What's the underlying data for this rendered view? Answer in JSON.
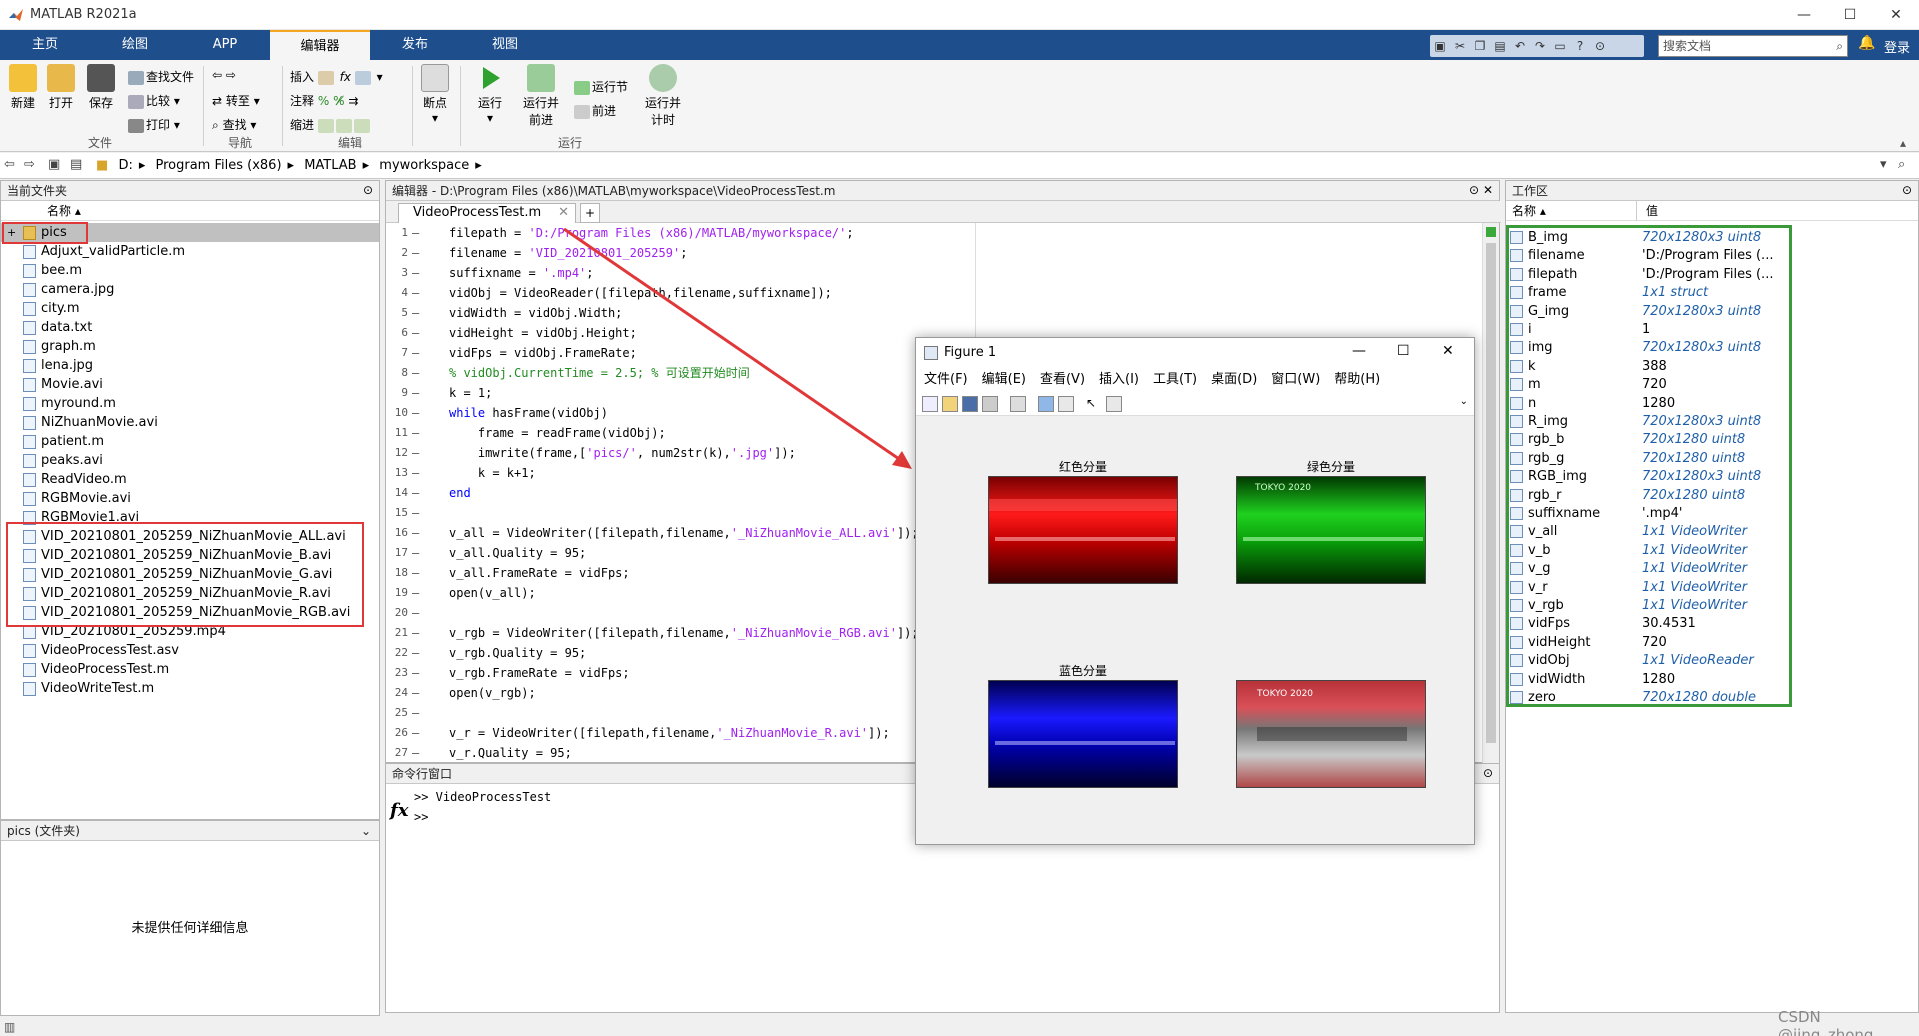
{
  "app": {
    "title": "MATLAB R2021a"
  },
  "ribbon_tabs": [
    "主页",
    "绘图",
    "APP",
    "编辑器",
    "发布",
    "视图"
  ],
  "search": {
    "placeholder": "搜索文档"
  },
  "login_label": "登录",
  "ribbon": {
    "new": "新建",
    "open": "打开",
    "save": "保存",
    "find_files": "查找文件",
    "compare": "比较",
    "print": "打印",
    "group_file": "文件",
    "goto": "转至",
    "find": "查找",
    "group_nav": "导航",
    "insert": "插入",
    "comment": "注释",
    "indent": "缩进",
    "group_edit": "编辑",
    "breakpoints": "断点",
    "run": "运行",
    "run_advance": "运行并\n前进",
    "run_section": "运行节",
    "advance": "前进",
    "run_time": "运行并\n计时",
    "group_run": "运行"
  },
  "address": [
    "D:",
    "Program Files (x86)",
    "MATLAB",
    "myworkspace"
  ],
  "file_browser": {
    "title": "当前文件夹",
    "col_name": "名称",
    "items": [
      "pics",
      "Adjuxt_validParticle.m",
      "bee.m",
      "camera.jpg",
      "city.m",
      "data.txt",
      "graph.m",
      "lena.jpg",
      "Movie.avi",
      "myround.m",
      "NiZhuanMovie.avi",
      "patient.m",
      "peaks.avi",
      "ReadVideo.m",
      "RGBMovie.avi",
      "RGBMovie1.avi",
      "VID_20210801_205259_NiZhuanMovie_ALL.avi",
      "VID_20210801_205259_NiZhuanMovie_B.avi",
      "VID_20210801_205259_NiZhuanMovie_G.avi",
      "VID_20210801_205259_NiZhuanMovie_R.avi",
      "VID_20210801_205259_NiZhuanMovie_RGB.avi",
      "VID_20210801_205259.mp4",
      "VideoProcessTest.asv",
      "VideoProcessTest.m",
      "VideoWriteTest.m"
    ],
    "details_title": "pics (文件夹)",
    "details_text": "未提供任何详细信息"
  },
  "editor": {
    "title": "编辑器 - D:\\Program Files (x86)\\MATLAB\\myworkspace\\VideoProcessTest.m",
    "tab": "VideoProcessTest.m",
    "lines": [
      {
        "n": "1",
        "parts": [
          [
            "",
            "filepath = "
          ],
          [
            "str",
            "'D:/Program Files (x86)/MATLAB/myworkspace/'"
          ],
          [
            "",
            ";"
          ]
        ]
      },
      {
        "n": "2",
        "parts": [
          [
            "",
            "filename = "
          ],
          [
            "str",
            "'VID_20210801_205259'"
          ],
          [
            "",
            ";"
          ]
        ]
      },
      {
        "n": "3",
        "parts": [
          [
            "",
            "suffixname = "
          ],
          [
            "str",
            "'.mp4'"
          ],
          [
            "",
            ";"
          ]
        ]
      },
      {
        "n": "4",
        "parts": [
          [
            "",
            "vidObj = VideoReader([filepath,filename,suffixname]);"
          ]
        ]
      },
      {
        "n": "5",
        "parts": [
          [
            "",
            "vidWidth = vidObj.Width;"
          ]
        ]
      },
      {
        "n": "6",
        "parts": [
          [
            "",
            "vidHeight = vidObj.Height;"
          ]
        ]
      },
      {
        "n": "7",
        "parts": [
          [
            "",
            "vidFps = vidObj.FrameRate;"
          ]
        ]
      },
      {
        "n": "8",
        "parts": [
          [
            "cm",
            "% vidObj.CurrentTime = 2.5; % 可设置开始时间"
          ]
        ]
      },
      {
        "n": "9",
        "parts": [
          [
            "",
            "k = 1;"
          ]
        ]
      },
      {
        "n": "10",
        "parts": [
          [
            "kw",
            "while"
          ],
          [
            "",
            " hasFrame(vidObj)"
          ]
        ]
      },
      {
        "n": "11",
        "parts": [
          [
            "",
            "    frame = readFrame(vidObj);"
          ]
        ]
      },
      {
        "n": "12",
        "parts": [
          [
            "",
            "    imwrite(frame,["
          ],
          [
            "str",
            "'pics/'"
          ],
          [
            "",
            ", num2str(k),"
          ],
          [
            "str",
            "'.jpg'"
          ],
          [
            "",
            "]);"
          ]
        ]
      },
      {
        "n": "13",
        "parts": [
          [
            "",
            "    k = k+1;"
          ]
        ]
      },
      {
        "n": "14",
        "parts": [
          [
            "kw",
            "end"
          ]
        ]
      },
      {
        "n": "15",
        "parts": [
          [
            "",
            ""
          ]
        ]
      },
      {
        "n": "16",
        "parts": [
          [
            "",
            "v_all = VideoWriter([filepath,filename,"
          ],
          [
            "str",
            "'_NiZhuanMovie_ALL.avi'"
          ],
          [
            "",
            "]);"
          ]
        ]
      },
      {
        "n": "17",
        "parts": [
          [
            "",
            "v_all.Quality = 95;"
          ]
        ]
      },
      {
        "n": "18",
        "parts": [
          [
            "",
            "v_all.FrameRate = vidFps;"
          ]
        ]
      },
      {
        "n": "19",
        "parts": [
          [
            "",
            "open(v_all);"
          ]
        ]
      },
      {
        "n": "20",
        "parts": [
          [
            "",
            ""
          ]
        ]
      },
      {
        "n": "21",
        "parts": [
          [
            "",
            "v_rgb = VideoWriter([filepath,filename,"
          ],
          [
            "str",
            "'_NiZhuanMovie_RGB.avi'"
          ],
          [
            "",
            "]);"
          ]
        ]
      },
      {
        "n": "22",
        "parts": [
          [
            "",
            "v_rgb.Quality = 95;"
          ]
        ]
      },
      {
        "n": "23",
        "parts": [
          [
            "",
            "v_rgb.FrameRate = vidFps;"
          ]
        ]
      },
      {
        "n": "24",
        "parts": [
          [
            "",
            "open(v_rgb);"
          ]
        ]
      },
      {
        "n": "25",
        "parts": [
          [
            "",
            ""
          ]
        ]
      },
      {
        "n": "26",
        "parts": [
          [
            "",
            "v_r = VideoWriter([filepath,filename,"
          ],
          [
            "str",
            "'_NiZhuanMovie_R.avi'"
          ],
          [
            "",
            "]);"
          ]
        ]
      },
      {
        "n": "27",
        "parts": [
          [
            "",
            "v_r.Quality = 95;"
          ]
        ]
      }
    ]
  },
  "command_window": {
    "title": "命令行窗口",
    "history": ">> VideoProcessTest",
    "prompt": ">>",
    "fx": "fx"
  },
  "workspace": {
    "title": "工作区",
    "col_name": "名称",
    "col_value": "值",
    "vars": [
      {
        "name": "B_img",
        "value": "720x1280x3 uint8",
        "italic": true
      },
      {
        "name": "filename",
        "value": "'D:/Program Files (...",
        "italic": false
      },
      {
        "name": "filepath",
        "value": "'D:/Program Files (...",
        "italic": false
      },
      {
        "name": "frame",
        "value": "1x1 struct",
        "italic": true
      },
      {
        "name": "G_img",
        "value": "720x1280x3 uint8",
        "italic": true
      },
      {
        "name": "i",
        "value": "1",
        "italic": false
      },
      {
        "name": "img",
        "value": "720x1280x3 uint8",
        "italic": true
      },
      {
        "name": "k",
        "value": "388",
        "italic": false
      },
      {
        "name": "m",
        "value": "720",
        "italic": false
      },
      {
        "name": "n",
        "value": "1280",
        "italic": false
      },
      {
        "name": "R_img",
        "value": "720x1280x3 uint8",
        "italic": true
      },
      {
        "name": "rgb_b",
        "value": "720x1280 uint8",
        "italic": true
      },
      {
        "name": "rgb_g",
        "value": "720x1280 uint8",
        "italic": true
      },
      {
        "name": "RGB_img",
        "value": "720x1280x3 uint8",
        "italic": true
      },
      {
        "name": "rgb_r",
        "value": "720x1280 uint8",
        "italic": true
      },
      {
        "name": "suffixname",
        "value": "'.mp4'",
        "italic": false
      },
      {
        "name": "v_all",
        "value": "1x1 VideoWriter",
        "italic": true
      },
      {
        "name": "v_b",
        "value": "1x1 VideoWriter",
        "italic": true
      },
      {
        "name": "v_g",
        "value": "1x1 VideoWriter",
        "italic": true
      },
      {
        "name": "v_r",
        "value": "1x1 VideoWriter",
        "italic": true
      },
      {
        "name": "v_rgb",
        "value": "1x1 VideoWriter",
        "italic": true
      },
      {
        "name": "vidFps",
        "value": "30.4531",
        "italic": false
      },
      {
        "name": "vidHeight",
        "value": "720",
        "italic": false
      },
      {
        "name": "vidObj",
        "value": "1x1 VideoReader",
        "italic": true
      },
      {
        "name": "vidWidth",
        "value": "1280",
        "italic": false
      },
      {
        "name": "zero",
        "value": "720x1280 double",
        "italic": true
      }
    ]
  },
  "figure": {
    "title": "Figure 1",
    "menu": [
      "文件(F)",
      "编辑(E)",
      "查看(V)",
      "插入(I)",
      "工具(T)",
      "桌面(D)",
      "窗口(W)",
      "帮助(H)"
    ],
    "subplots": [
      "红色分量",
      "绿色分量",
      "蓝色分量",
      ""
    ],
    "image_text": [
      "TOKYO 2020",
      "TOKYO 2020",
      "",
      "TOKYO 2020"
    ]
  },
  "watermark": "CSDN @jing_zhong",
  "colors": {
    "tabbar": "#1f4e8c",
    "red_annotation": "#e03838",
    "green_annotation": "#3a9a3a",
    "string": "#a020f0",
    "keyword": "#0000ff",
    "comment": "#228b22"
  }
}
